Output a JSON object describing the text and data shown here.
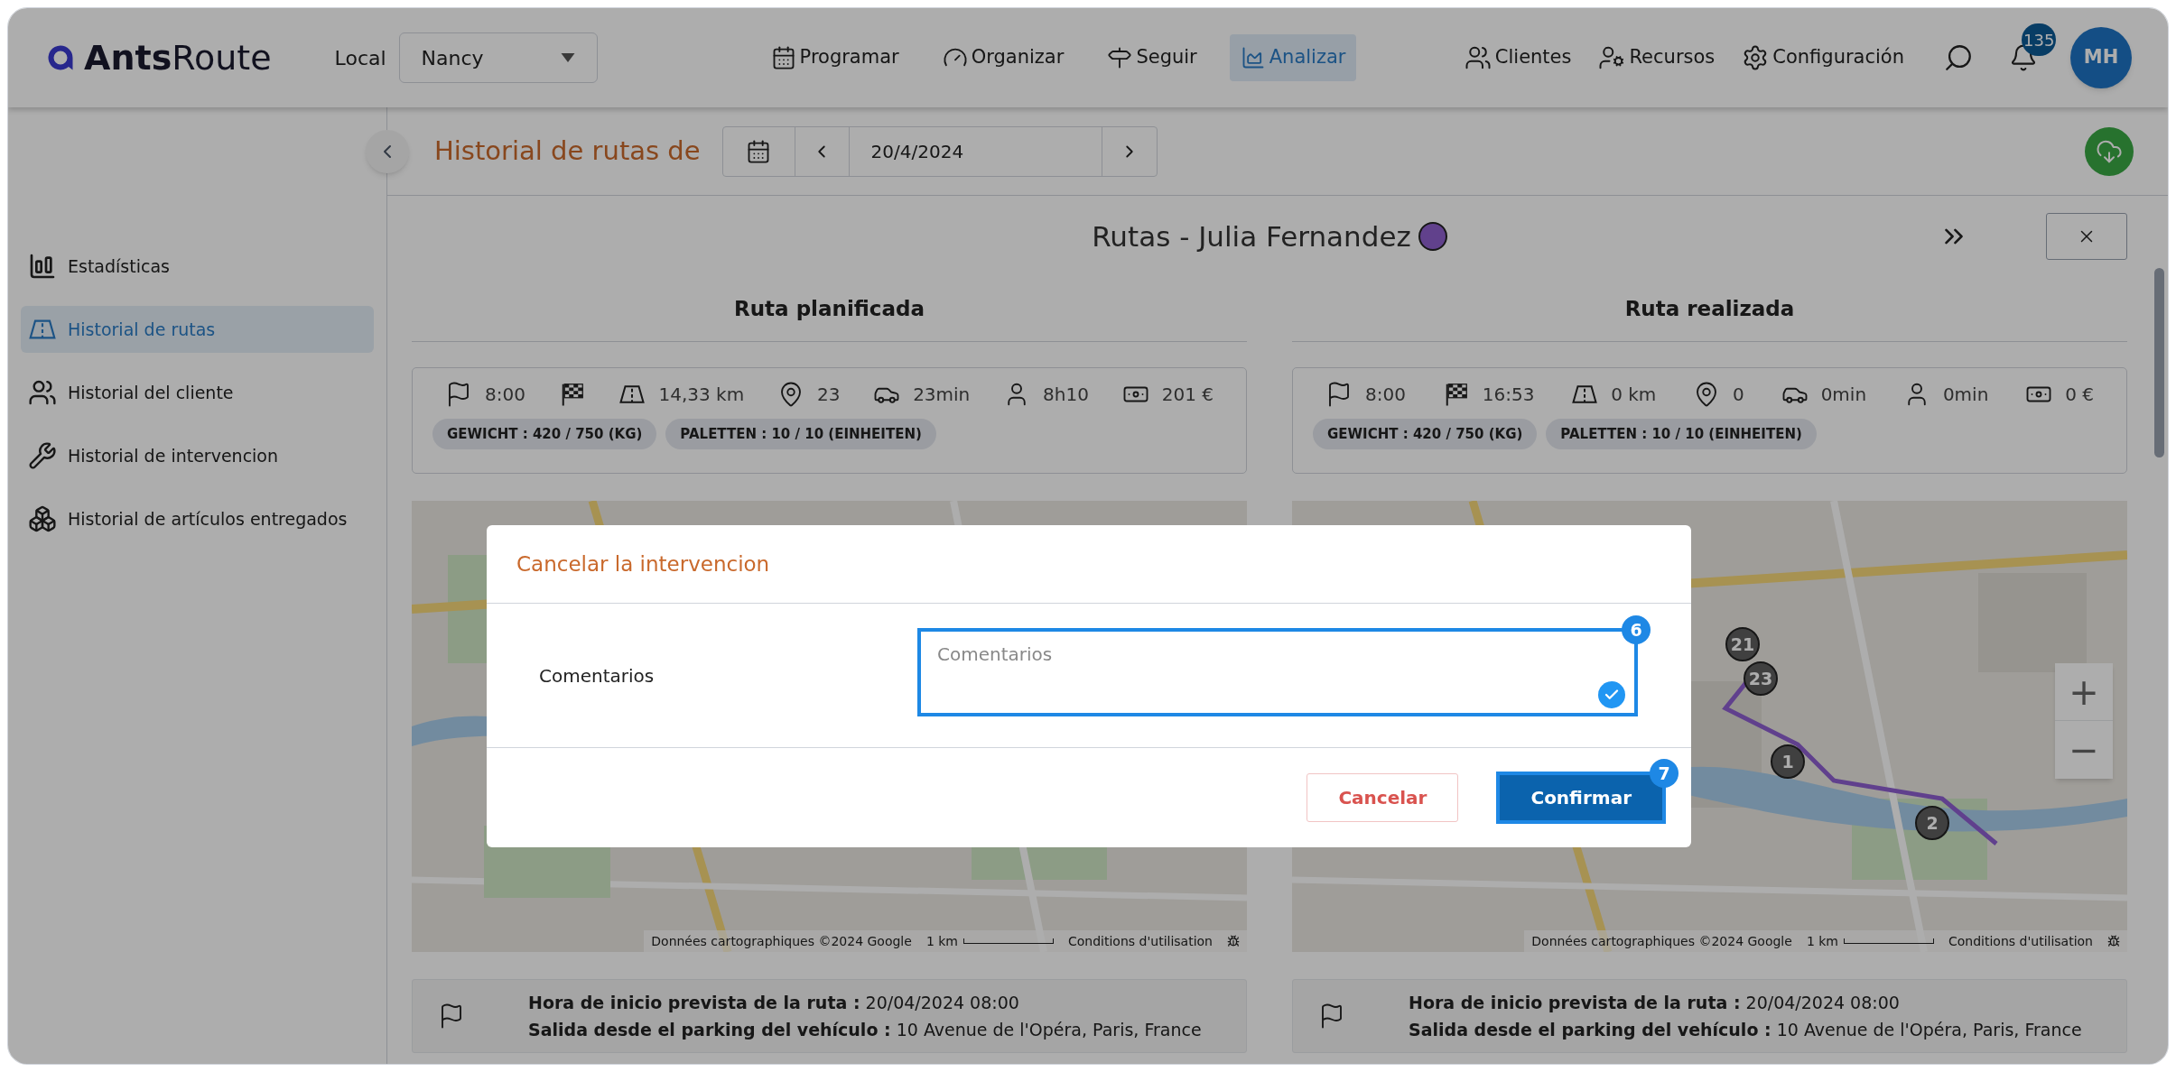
{
  "header": {
    "logo": {
      "bold": "Ants",
      "light": "Route"
    },
    "local_label": "Local",
    "local_value": "Nancy",
    "nav": [
      {
        "label": "Programar",
        "selected": false
      },
      {
        "label": "Organizar",
        "selected": false
      },
      {
        "label": "Seguir",
        "selected": false
      },
      {
        "label": "Analizar",
        "selected": true
      }
    ],
    "right_nav": [
      {
        "label": "Clientes"
      },
      {
        "label": "Recursos"
      },
      {
        "label": "Configuración"
      }
    ],
    "notifications": "135",
    "avatar": "MH"
  },
  "subheader": {
    "title": "Historial de rutas de",
    "date": "20/4/2024"
  },
  "sidebar": {
    "items": [
      {
        "label": "Estadísticas",
        "selected": false
      },
      {
        "label": "Historial de rutas",
        "selected": true
      },
      {
        "label": "Historial del cliente",
        "selected": false
      },
      {
        "label": "Historial de intervencion",
        "selected": false
      },
      {
        "label": "Historial de artículos entregados",
        "selected": false
      }
    ]
  },
  "route_panel": {
    "title": "Rutas - Julia Fernandez",
    "color": "#61418d",
    "columns": [
      {
        "heading": "Ruta planificada",
        "stats": [
          {
            "kind": "start",
            "value": "8:00"
          },
          {
            "kind": "end"
          },
          {
            "kind": "distance",
            "value": "14,33 km"
          },
          {
            "kind": "stops",
            "value": "23"
          },
          {
            "kind": "drive",
            "value": "23min"
          },
          {
            "kind": "work",
            "value": "8h10"
          },
          {
            "kind": "cost",
            "value": "201 €"
          }
        ],
        "tags": [
          "GEWICHT : 420 / 750 (KG)",
          "PALETTEN : 10 / 10 (EINHEITEN)"
        ],
        "map": {
          "attribution": [
            "Données cartographiques ©2024 Google",
            "1 km",
            "Conditions d'utilisation"
          ]
        },
        "info": [
          "**Hora de inicio prevista de la ruta :** 20/04/2024 08:00",
          "**Salida desde el parking del vehículo :** 10 Avenue de l'Opéra, Paris, France"
        ]
      },
      {
        "heading": "Ruta realizada",
        "stats": [
          {
            "kind": "start",
            "value": "8:00"
          },
          {
            "kind": "end",
            "value": "16:53"
          },
          {
            "kind": "distance",
            "value": "0 km"
          },
          {
            "kind": "stops",
            "value": "0"
          },
          {
            "kind": "drive",
            "value": "0min"
          },
          {
            "kind": "work",
            "value": "0min"
          },
          {
            "kind": "cost",
            "value": "0 €"
          }
        ],
        "tags": [
          "GEWICHT : 420 / 750 (KG)",
          "PALETTEN : 10 / 10 (EINHEITEN)"
        ],
        "map": {
          "pins": [
            {
              "label": "21"
            },
            {
              "label": "23"
            },
            {
              "label": "1"
            },
            {
              "label": "2"
            }
          ],
          "zoom_controls": [
            "+",
            "−"
          ],
          "attribution": [
            "Données cartographiques ©2024 Google",
            "1 km",
            "Conditions d'utilisation"
          ]
        },
        "info": [
          "**Hora de inicio prevista de la ruta :** 20/04/2024 08:00",
          "**Salida desde el parking del vehículo :** 10 Avenue de l'Opéra, Paris, France"
        ]
      }
    ]
  },
  "modal": {
    "title": "Cancelar la intervencion",
    "field_label": "Comentarios",
    "placeholder": "Comentarios",
    "field_step": "6",
    "confirm_step": "7",
    "buttons": [
      {
        "kind": "cancel",
        "label": "Cancelar"
      },
      {
        "kind": "confirm",
        "label": "Confirmar"
      }
    ]
  }
}
